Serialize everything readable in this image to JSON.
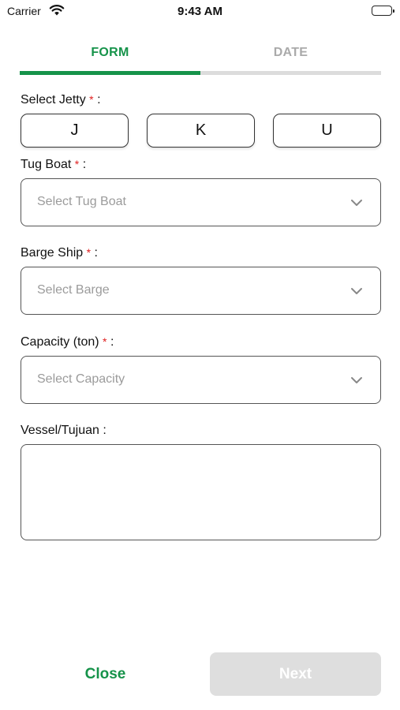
{
  "status_bar": {
    "carrier": "Carrier",
    "time": "9:43 AM",
    "icons": [
      "wifi-icon",
      "battery-icon"
    ]
  },
  "tabs": [
    {
      "label": "FORM",
      "active": true
    },
    {
      "label": "DATE",
      "active": false
    }
  ],
  "progress_fraction": 0.5,
  "colors": {
    "accent": "#16934a",
    "required": "#e02020",
    "inactive_tab": "#aaaaaa",
    "disabled_button": "#dedede"
  },
  "form": {
    "jetty": {
      "label": "Select Jetty",
      "required_mark": "*",
      "suffix": ":",
      "options": [
        "J",
        "K",
        "U"
      ]
    },
    "tug_boat": {
      "label": "Tug Boat",
      "required_mark": "*",
      "suffix": ":",
      "placeholder": "Select Tug Boat",
      "icon": "chevron-down-icon"
    },
    "barge_ship": {
      "label": "Barge Ship",
      "required_mark": "*",
      "suffix": ":",
      "placeholder": "Select Barge",
      "icon": "chevron-down-icon"
    },
    "capacity": {
      "label": "Capacity (ton)",
      "required_mark": "*",
      "suffix": ":",
      "placeholder": "Select Capacity",
      "icon": "chevron-down-icon"
    },
    "vessel": {
      "label": "Vessel/Tujuan :",
      "value": ""
    }
  },
  "footer": {
    "close_label": "Close",
    "next_label": "Next",
    "next_enabled": false
  }
}
